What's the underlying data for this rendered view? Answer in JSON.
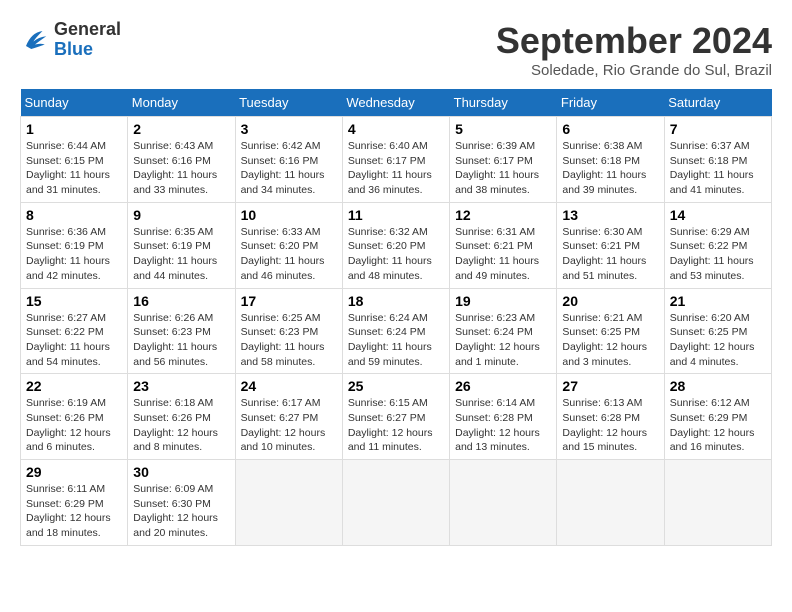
{
  "logo": {
    "general": "General",
    "blue": "Blue"
  },
  "title": "September 2024",
  "location": "Soledade, Rio Grande do Sul, Brazil",
  "days_of_week": [
    "Sunday",
    "Monday",
    "Tuesday",
    "Wednesday",
    "Thursday",
    "Friday",
    "Saturday"
  ],
  "weeks": [
    [
      {
        "day": "1",
        "sunrise": "6:44 AM",
        "sunset": "6:15 PM",
        "daylight": "11 hours and 31 minutes."
      },
      {
        "day": "2",
        "sunrise": "6:43 AM",
        "sunset": "6:16 PM",
        "daylight": "11 hours and 33 minutes."
      },
      {
        "day": "3",
        "sunrise": "6:42 AM",
        "sunset": "6:16 PM",
        "daylight": "11 hours and 34 minutes."
      },
      {
        "day": "4",
        "sunrise": "6:40 AM",
        "sunset": "6:17 PM",
        "daylight": "11 hours and 36 minutes."
      },
      {
        "day": "5",
        "sunrise": "6:39 AM",
        "sunset": "6:17 PM",
        "daylight": "11 hours and 38 minutes."
      },
      {
        "day": "6",
        "sunrise": "6:38 AM",
        "sunset": "6:18 PM",
        "daylight": "11 hours and 39 minutes."
      },
      {
        "day": "7",
        "sunrise": "6:37 AM",
        "sunset": "6:18 PM",
        "daylight": "11 hours and 41 minutes."
      }
    ],
    [
      {
        "day": "8",
        "sunrise": "6:36 AM",
        "sunset": "6:19 PM",
        "daylight": "11 hours and 42 minutes."
      },
      {
        "day": "9",
        "sunrise": "6:35 AM",
        "sunset": "6:19 PM",
        "daylight": "11 hours and 44 minutes."
      },
      {
        "day": "10",
        "sunrise": "6:33 AM",
        "sunset": "6:20 PM",
        "daylight": "11 hours and 46 minutes."
      },
      {
        "day": "11",
        "sunrise": "6:32 AM",
        "sunset": "6:20 PM",
        "daylight": "11 hours and 48 minutes."
      },
      {
        "day": "12",
        "sunrise": "6:31 AM",
        "sunset": "6:21 PM",
        "daylight": "11 hours and 49 minutes."
      },
      {
        "day": "13",
        "sunrise": "6:30 AM",
        "sunset": "6:21 PM",
        "daylight": "11 hours and 51 minutes."
      },
      {
        "day": "14",
        "sunrise": "6:29 AM",
        "sunset": "6:22 PM",
        "daylight": "11 hours and 53 minutes."
      }
    ],
    [
      {
        "day": "15",
        "sunrise": "6:27 AM",
        "sunset": "6:22 PM",
        "daylight": "11 hours and 54 minutes."
      },
      {
        "day": "16",
        "sunrise": "6:26 AM",
        "sunset": "6:23 PM",
        "daylight": "11 hours and 56 minutes."
      },
      {
        "day": "17",
        "sunrise": "6:25 AM",
        "sunset": "6:23 PM",
        "daylight": "11 hours and 58 minutes."
      },
      {
        "day": "18",
        "sunrise": "6:24 AM",
        "sunset": "6:24 PM",
        "daylight": "11 hours and 59 minutes."
      },
      {
        "day": "19",
        "sunrise": "6:23 AM",
        "sunset": "6:24 PM",
        "daylight": "12 hours and 1 minute."
      },
      {
        "day": "20",
        "sunrise": "6:21 AM",
        "sunset": "6:25 PM",
        "daylight": "12 hours and 3 minutes."
      },
      {
        "day": "21",
        "sunrise": "6:20 AM",
        "sunset": "6:25 PM",
        "daylight": "12 hours and 4 minutes."
      }
    ],
    [
      {
        "day": "22",
        "sunrise": "6:19 AM",
        "sunset": "6:26 PM",
        "daylight": "12 hours and 6 minutes."
      },
      {
        "day": "23",
        "sunrise": "6:18 AM",
        "sunset": "6:26 PM",
        "daylight": "12 hours and 8 minutes."
      },
      {
        "day": "24",
        "sunrise": "6:17 AM",
        "sunset": "6:27 PM",
        "daylight": "12 hours and 10 minutes."
      },
      {
        "day": "25",
        "sunrise": "6:15 AM",
        "sunset": "6:27 PM",
        "daylight": "12 hours and 11 minutes."
      },
      {
        "day": "26",
        "sunrise": "6:14 AM",
        "sunset": "6:28 PM",
        "daylight": "12 hours and 13 minutes."
      },
      {
        "day": "27",
        "sunrise": "6:13 AM",
        "sunset": "6:28 PM",
        "daylight": "12 hours and 15 minutes."
      },
      {
        "day": "28",
        "sunrise": "6:12 AM",
        "sunset": "6:29 PM",
        "daylight": "12 hours and 16 minutes."
      }
    ],
    [
      {
        "day": "29",
        "sunrise": "6:11 AM",
        "sunset": "6:29 PM",
        "daylight": "12 hours and 18 minutes."
      },
      {
        "day": "30",
        "sunrise": "6:09 AM",
        "sunset": "6:30 PM",
        "daylight": "12 hours and 20 minutes."
      },
      null,
      null,
      null,
      null,
      null
    ]
  ],
  "labels": {
    "sunrise": "Sunrise:",
    "sunset": "Sunset:",
    "daylight": "Daylight:"
  }
}
